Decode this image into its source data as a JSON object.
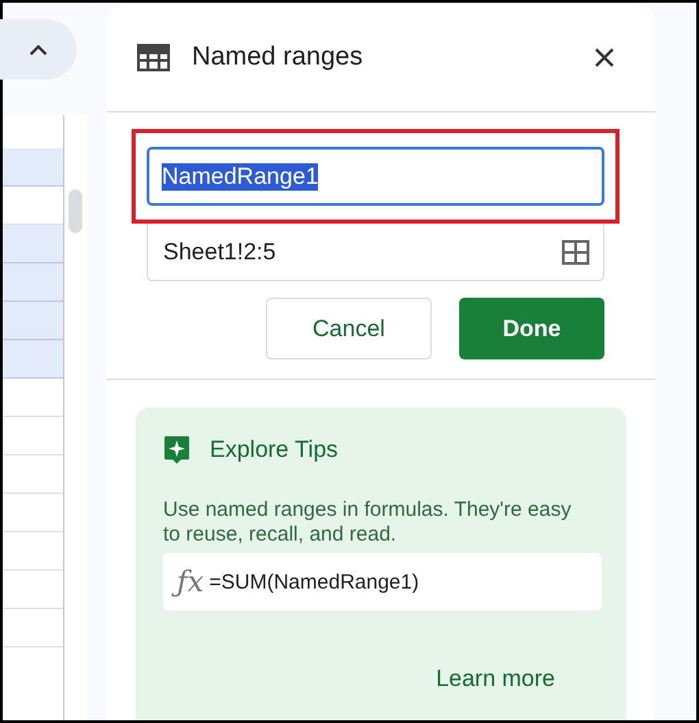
{
  "sheet": {
    "rows": [
      {
        "selected": true
      },
      {
        "selected": false
      },
      {
        "selected": true
      },
      {
        "selected": true
      },
      {
        "selected": true
      },
      {
        "selected": true
      },
      {
        "selected": false
      },
      {
        "selected": false
      },
      {
        "selected": false
      },
      {
        "selected": false
      },
      {
        "selected": false
      },
      {
        "selected": false
      },
      {
        "selected": false
      }
    ]
  },
  "panel": {
    "title": "Named ranges",
    "name_field": {
      "value": "NamedRange1",
      "text_selected": true,
      "highlighted": true
    },
    "range_field": {
      "value": "Sheet1!2:5"
    },
    "buttons": [
      {
        "label": "Cancel",
        "kind": "secondary"
      },
      {
        "label": "Done",
        "kind": "primary"
      }
    ],
    "tips": {
      "title": "Explore Tips",
      "text": "Use named ranges in formulas. They're easy to reuse, recall, and read.",
      "formula_icon": "ƒx",
      "formula": "=SUM(NamedRange1)",
      "link": "Learn more"
    }
  }
}
